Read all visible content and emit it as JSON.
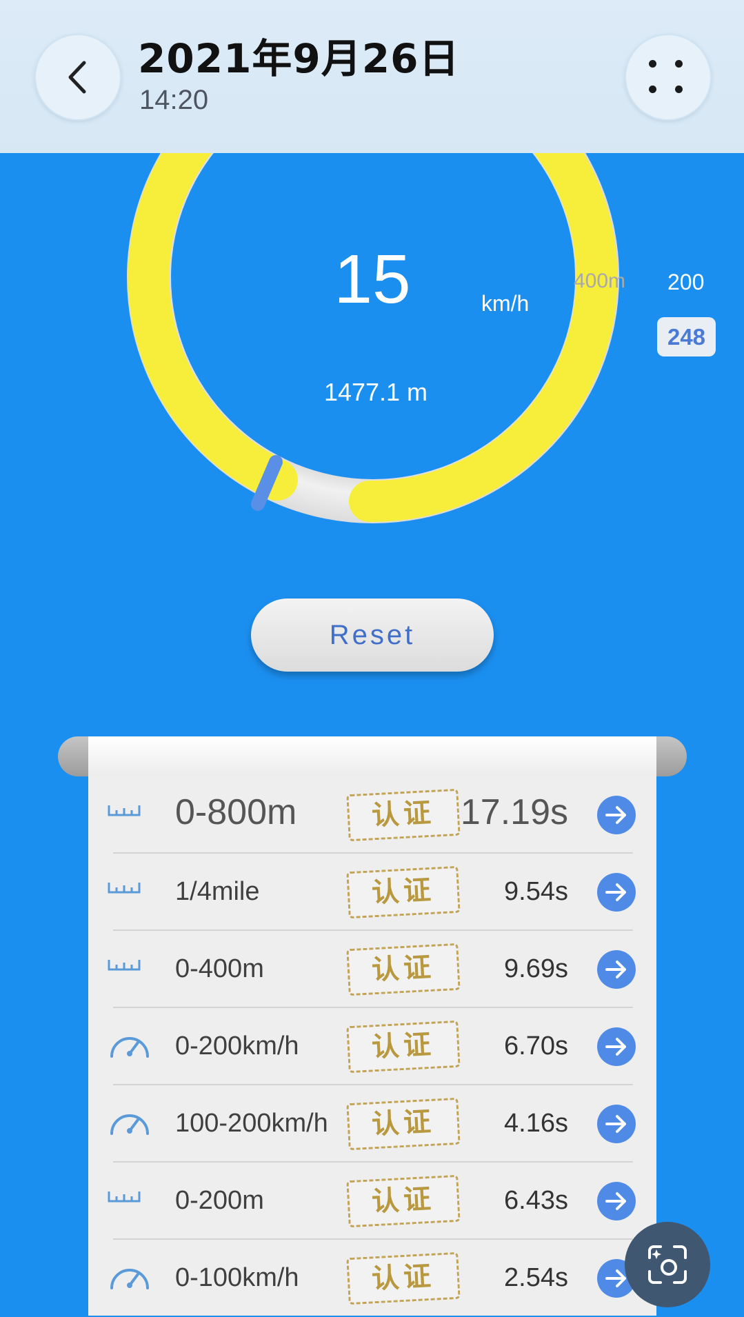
{
  "header": {
    "title": "2021年9月26日",
    "subtitle": "14:20",
    "back_icon": "chevron-left-icon",
    "more_icon": "more-dots-icon"
  },
  "gauge": {
    "speed": "15",
    "unit": "km/h",
    "distance": "1477.1 m",
    "mark_400": "400m",
    "mark_200": "200",
    "badge": "248",
    "ring_color": "#f6ee3a",
    "needle_color": "#5a8fe8"
  },
  "reset": {
    "label": "Reset"
  },
  "results": {
    "stamp_label": "认证",
    "rows": [
      {
        "label": "0-800m",
        "icon": "ruler-icon",
        "time": "17.19s"
      },
      {
        "label": "1/4mile",
        "icon": "ruler-icon",
        "time": "9.54s"
      },
      {
        "label": "0-400m",
        "icon": "ruler-icon",
        "time": "9.69s"
      },
      {
        "label": "0-200km/h",
        "icon": "speedometer-icon",
        "time": "6.70s"
      },
      {
        "label": "100-200km/h",
        "icon": "speedometer-icon",
        "time": "4.16s"
      },
      {
        "label": "0-200m",
        "icon": "ruler-icon",
        "time": "6.43s"
      },
      {
        "label": "0-100km/h",
        "icon": "speedometer-icon",
        "time": "2.54s"
      }
    ]
  },
  "floating": {
    "icon": "screenshot-camera-icon"
  },
  "colors": {
    "background": "#1b8ff0",
    "accent": "#4f8be6",
    "stamp": "#c3a457"
  }
}
